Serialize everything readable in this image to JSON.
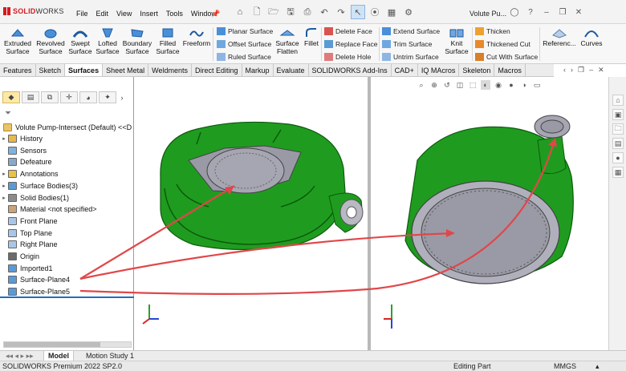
{
  "app": {
    "brand_bold": "SOLID",
    "brand_rest": "WORKS",
    "menu": [
      "File",
      "Edit",
      "View",
      "Insert",
      "Tools",
      "Window"
    ],
    "document_title": "Volute Pu..."
  },
  "ribbon": {
    "large_buttons": [
      {
        "label": "Extruded Surface"
      },
      {
        "label": "Revolved Surface"
      },
      {
        "label": "Swept Surface"
      },
      {
        "label": "Lofted Surface"
      },
      {
        "label": "Boundary Surface"
      },
      {
        "label": "Filled Surface"
      },
      {
        "label": "Freeform"
      }
    ],
    "group_a": [
      "Planar Surface",
      "Offset Surface",
      "Ruled Surface"
    ],
    "surface_flatten": "Surface Flatten",
    "fillet": "Fillet",
    "group_b": [
      "Delete Face",
      "Replace Face",
      "Delete Hole"
    ],
    "group_c": [
      "Extend Surface",
      "Trim Surface",
      "Untrim Surface"
    ],
    "knit": "Knit Surface",
    "group_d": [
      "Thicken",
      "Thickened Cut",
      "Cut With Surface"
    ],
    "reference": "Referenc...",
    "curves": "Curves"
  },
  "tabs": [
    "Features",
    "Sketch",
    "Surfaces",
    "Sheet Metal",
    "Weldments",
    "Direct Editing",
    "Markup",
    "Evaluate",
    "SOLIDWORKS Add-Ins",
    "CAD+",
    "IQ MAcros",
    "Skeleton",
    "Macros"
  ],
  "active_tab": "Surfaces",
  "tree": {
    "root": "Volute Pump-Intersect (Default) <<D",
    "items": [
      {
        "label": "History",
        "expandable": true
      },
      {
        "label": "Sensors",
        "expandable": false
      },
      {
        "label": "Defeature",
        "expandable": false
      },
      {
        "label": "Annotations",
        "expandable": true
      },
      {
        "label": "Surface Bodies(3)",
        "expandable": true
      },
      {
        "label": "Solid Bodies(1)",
        "expandable": true
      },
      {
        "label": "Material <not specified>",
        "expandable": false
      },
      {
        "label": "Front Plane",
        "expandable": false
      },
      {
        "label": "Top Plane",
        "expandable": false
      },
      {
        "label": "Right Plane",
        "expandable": false
      },
      {
        "label": "Origin",
        "expandable": false
      },
      {
        "label": "Imported1",
        "expandable": false
      },
      {
        "label": "Surface-Plane4",
        "expandable": false
      },
      {
        "label": "Surface-Plane5",
        "expandable": false
      }
    ]
  },
  "bottom_tabs": [
    "Model",
    "Motion Study 1"
  ],
  "status": {
    "product": "SOLIDWORKS Premium 2022 SP2.0",
    "mode": "Editing Part",
    "units": "MMGS"
  },
  "colors": {
    "part_green": "#1f9c1f",
    "face_gray": "#9a9aa6",
    "arrow_red": "#e0474a",
    "selection_blue": "#1f6fbf"
  }
}
